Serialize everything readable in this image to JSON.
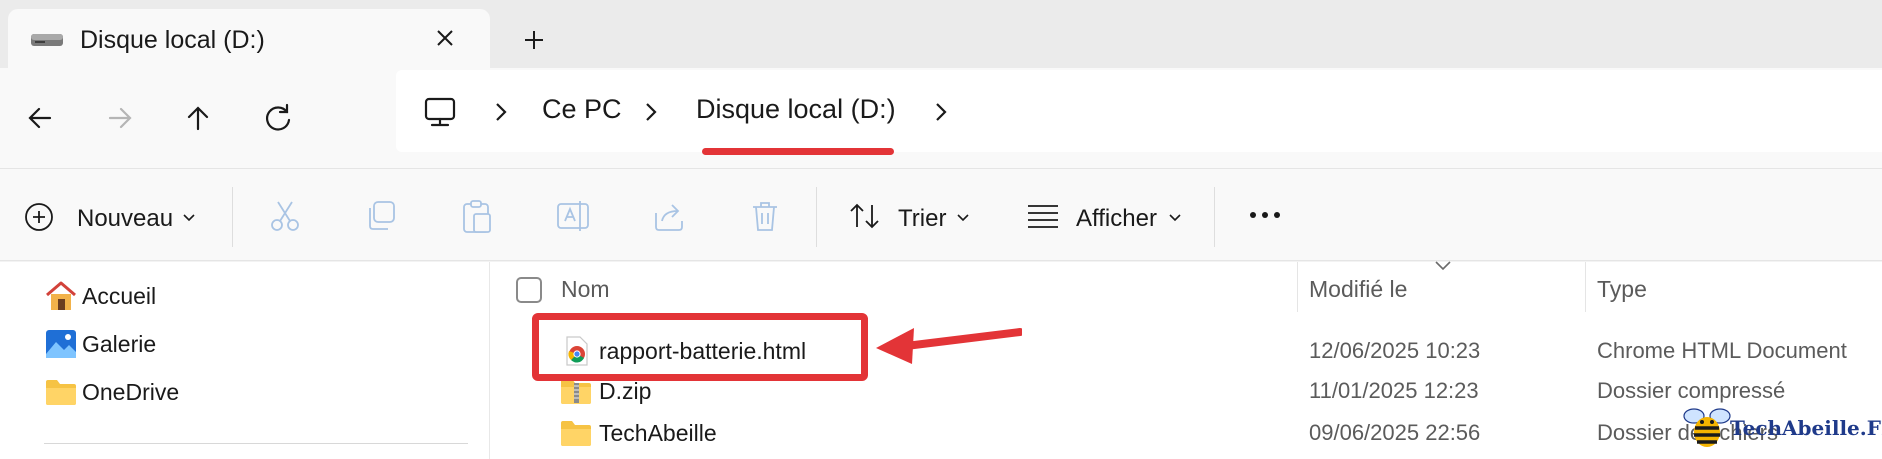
{
  "tab": {
    "title": "Disque local (D:)"
  },
  "breadcrumb": {
    "items": [
      "Ce PC",
      "Disque local (D:)"
    ]
  },
  "commands": {
    "new": "Nouveau",
    "sort": "Trier",
    "view": "Afficher"
  },
  "sidebar": {
    "items": [
      "Accueil",
      "Galerie",
      "OneDrive"
    ]
  },
  "columns": {
    "name": "Nom",
    "modified": "Modifié le",
    "type": "Type"
  },
  "files": [
    {
      "name": "rapport-batterie.html",
      "modified": "12/06/2025 10:23",
      "type": "Chrome HTML Document",
      "icon": "chrome-icon"
    },
    {
      "name": "D.zip",
      "modified": "11/01/2025 12:23",
      "type": "Dossier compressé",
      "icon": "zip-folder-icon"
    },
    {
      "name": "TechAbeille",
      "modified": "09/06/2025 22:56",
      "type": "Dossier de fichiers",
      "icon": "folder-icon"
    }
  ],
  "watermark": {
    "text": "TechAbeille.FR"
  },
  "colors": {
    "annotation_red": "#e33437",
    "folder_yellow": "#f6c344",
    "watermark_blue": "#1f3a8a"
  }
}
